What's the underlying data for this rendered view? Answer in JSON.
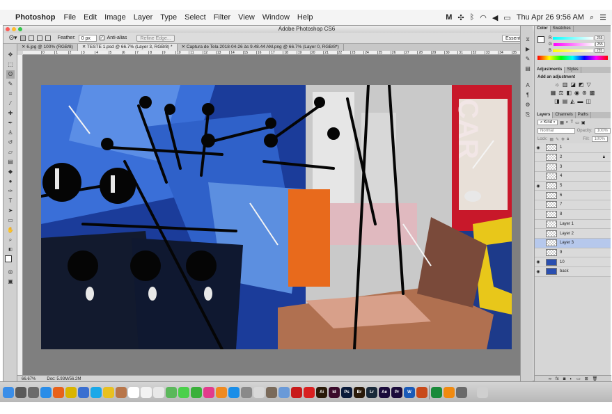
{
  "menubar": {
    "items": [
      "Photoshop",
      "File",
      "Edit",
      "Image",
      "Layer",
      "Type",
      "Select",
      "Filter",
      "View",
      "Window",
      "Help"
    ],
    "clock": "Thu Apr 26  9:56 AM"
  },
  "window": {
    "title": "Adobe Photoshop CS6"
  },
  "options": {
    "feather_label": "Feather:",
    "feather_value": "0 px",
    "antialias_label": "Anti-alias",
    "refine_edge_label": "Refine Edge...",
    "workspace": "Essentials"
  },
  "tabs": [
    "6.jpg @ 100% (RGB/8)",
    "TESTE 1.psd @ 66.7% (Layer 3, RGB/8) *",
    "Captura de Tela 2018-04-26 às 9.48.44 AM.png @ 66.7% (Layer 0, RGB/8*)"
  ],
  "ruler_ticks": [
    "0",
    "1",
    "2",
    "3",
    "4",
    "5",
    "6",
    "7",
    "8",
    "9",
    "10",
    "11",
    "12",
    "13",
    "14",
    "15",
    "16",
    "17",
    "18",
    "19",
    "20",
    "21",
    "22",
    "23",
    "24",
    "25",
    "26",
    "27",
    "28",
    "29",
    "30",
    "31",
    "32",
    "33",
    "34",
    "35"
  ],
  "status": {
    "zoom": "66.67%",
    "doc": "Doc: 5.93M/56.2M"
  },
  "color_panel": {
    "tabs": [
      "Color",
      "Swatches"
    ],
    "channels": [
      {
        "label": "R",
        "value": "255",
        "color": "#ff0000"
      },
      {
        "label": "G",
        "value": "255",
        "color": "#00c000"
      },
      {
        "label": "B",
        "value": "255",
        "color": "#0040ff"
      }
    ]
  },
  "adjustments_panel": {
    "tabs": [
      "Adjustments",
      "Styles"
    ],
    "heading": "Add an adjustment"
  },
  "layers_panel": {
    "tabs": [
      "Layers",
      "Channels",
      "Paths"
    ],
    "kind_label": "Kind",
    "blend_mode": "Normal",
    "opacity_label": "Opacity:",
    "opacity_value": "100%",
    "lock_label": "Lock:",
    "fill_label": "Fill:",
    "fill_value": "100%",
    "layers": [
      {
        "name": "1",
        "visible": true,
        "selected": false,
        "locked": false
      },
      {
        "name": "2",
        "visible": false,
        "selected": false,
        "locked": true
      },
      {
        "name": "3",
        "visible": false,
        "selected": false,
        "locked": false
      },
      {
        "name": "4",
        "visible": false,
        "selected": false,
        "locked": false
      },
      {
        "name": "5",
        "visible": true,
        "selected": false,
        "locked": false
      },
      {
        "name": "6",
        "visible": false,
        "selected": false,
        "locked": false
      },
      {
        "name": "7",
        "visible": false,
        "selected": false,
        "locked": false
      },
      {
        "name": "8",
        "visible": false,
        "selected": false,
        "locked": false
      },
      {
        "name": "Layer 1",
        "visible": false,
        "selected": false,
        "locked": false
      },
      {
        "name": "Layer 2",
        "visible": false,
        "selected": false,
        "locked": false
      },
      {
        "name": "Layer 3",
        "visible": false,
        "selected": true,
        "locked": false
      },
      {
        "name": "9",
        "visible": false,
        "selected": false,
        "locked": false
      },
      {
        "name": "10",
        "visible": true,
        "selected": false,
        "locked": false
      },
      {
        "name": "back",
        "visible": true,
        "selected": false,
        "locked": false
      }
    ]
  },
  "tools": [
    "move-tool",
    "marquee-tool",
    "lasso-tool",
    "quick-select-tool",
    "crop-tool",
    "eyedropper-tool",
    "healing-tool",
    "brush-tool",
    "clone-stamp-tool",
    "history-brush-tool",
    "eraser-tool",
    "gradient-tool",
    "blur-tool",
    "dodge-tool",
    "pen-tool",
    "type-tool",
    "path-select-tool",
    "shape-tool",
    "hand-tool",
    "zoom-tool"
  ],
  "dock": [
    {
      "name": "finder-icon",
      "color": "#3b8ee8"
    },
    {
      "name": "launchpad-icon",
      "color": "#5a5a5a"
    },
    {
      "name": "mission-control-icon",
      "color": "#6b6b6b"
    },
    {
      "name": "safari-icon",
      "color": "#2a8de8"
    },
    {
      "name": "firefox-icon",
      "color": "#e8611a"
    },
    {
      "name": "chrome-icon",
      "color": "#d9b400"
    },
    {
      "name": "finder-alt-icon",
      "color": "#3a6fd0"
    },
    {
      "name": "skype-icon",
      "color": "#1aa8e8"
    },
    {
      "name": "notes-icon",
      "color": "#e8c020"
    },
    {
      "name": "contacts-icon",
      "color": "#b8764a"
    },
    {
      "name": "calendar-icon",
      "color": "#ffffff"
    },
    {
      "name": "reminders-icon",
      "color": "#f2f2f2"
    },
    {
      "name": "photos-icon",
      "color": "#e8e8e8"
    },
    {
      "name": "maps-icon",
      "color": "#5bb85b"
    },
    {
      "name": "messages-icon",
      "color": "#4ad04a"
    },
    {
      "name": "facetime-icon",
      "color": "#3ab03a"
    },
    {
      "name": "itunes-icon",
      "color": "#e23b8c"
    },
    {
      "name": "ibooks-icon",
      "color": "#f08a20"
    },
    {
      "name": "app-store-icon",
      "color": "#1a8ee8"
    },
    {
      "name": "system-prefs-icon",
      "color": "#8a8a8a"
    },
    {
      "name": "text-edit-icon",
      "color": "#d8d8d8"
    },
    {
      "name": "script-icon",
      "color": "#7a6a5a"
    },
    {
      "name": "preview-icon",
      "color": "#6a9ad8"
    },
    {
      "name": "acrobat-icon",
      "color": "#c81a1a"
    },
    {
      "name": "acrobat-reader-icon",
      "color": "#d82020"
    },
    {
      "name": "illustrator-icon",
      "color": "#2a1a08"
    },
    {
      "name": "indesign-icon",
      "color": "#3a0a2a"
    },
    {
      "name": "photoshop-icon",
      "color": "#0a1a3a"
    },
    {
      "name": "bridge-icon",
      "color": "#2a1a0a"
    },
    {
      "name": "lightroom-icon",
      "color": "#1a2a3a"
    },
    {
      "name": "after-effects-icon",
      "color": "#1a0a3a"
    },
    {
      "name": "premiere-icon",
      "color": "#1a0a3a"
    },
    {
      "name": "word-icon",
      "color": "#1a5ab8"
    },
    {
      "name": "powerpoint-icon",
      "color": "#c84a1a"
    },
    {
      "name": "excel-icon",
      "color": "#1a8a3a"
    },
    {
      "name": "vlc-icon",
      "color": "#f08a10"
    },
    {
      "name": "utility-icon",
      "color": "#6a6a6a"
    },
    {
      "name": "trash-icon",
      "color": "#cfcfcf"
    }
  ],
  "dock_labels": {
    "illustrator": "Ai",
    "indesign": "Id",
    "photoshop": "Ps",
    "bridge": "Br",
    "lightroom": "Lr",
    "after_effects": "Ae",
    "premiere": "Pr",
    "word": "W"
  }
}
